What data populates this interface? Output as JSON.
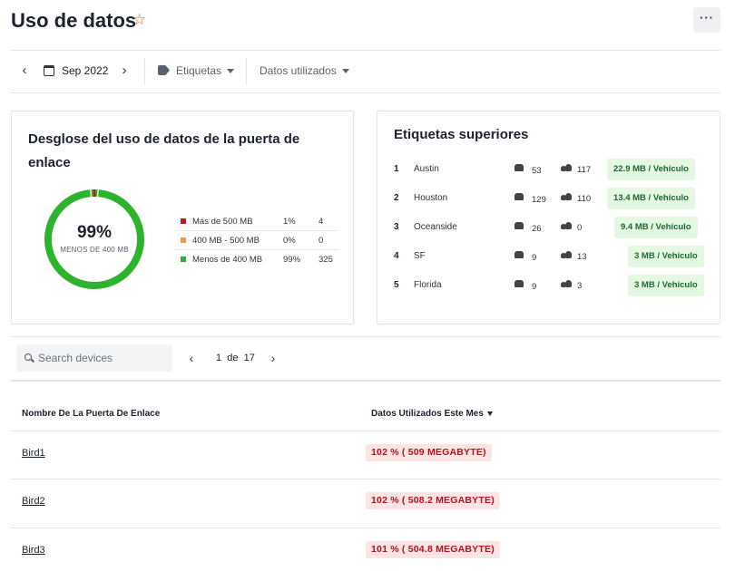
{
  "header": {
    "title": "Uso de datos",
    "favorite_icon": "star-icon",
    "more_label": "···"
  },
  "filters": {
    "prev_label": "‹",
    "next_label": "›",
    "date": "Sep 2022",
    "tags_label": "Etiquetas",
    "data_used_label": "Datos utilizados"
  },
  "breakdown": {
    "title": "Desglose del uso de datos de la puerta de enlace",
    "center_pct": "99%",
    "center_label": "MENOS DE 400 MB",
    "rows": [
      {
        "label": "Más de 500 MB",
        "pct": "1%",
        "count": "4",
        "color": "#c0171d",
        "fraction": 0.01
      },
      {
        "label": "400 MB - 500 MB",
        "pct": "0%",
        "count": "0",
        "color": "#f59a44",
        "fraction": 0.0
      },
      {
        "label": "Menos de 400 MB",
        "pct": "99%",
        "count": "325",
        "color": "#2db32d",
        "fraction": 0.99
      }
    ]
  },
  "top_tags": {
    "title": "Etiquetas superiores",
    "items": [
      {
        "rank": "1",
        "name": "Austin",
        "vehicles": "53",
        "people": "117",
        "badge": "22.9 MB / Vehículo"
      },
      {
        "rank": "2",
        "name": "Houston",
        "vehicles": "129",
        "people": "110",
        "badge": "13.4 MB / Vehículo"
      },
      {
        "rank": "3",
        "name": "Oceanside",
        "vehicles": "26",
        "people": "0",
        "badge": "9.4 MB / Vehículo"
      },
      {
        "rank": "4",
        "name": "SF",
        "vehicles": "9",
        "people": "13",
        "badge": "3 MB / Vehículo"
      },
      {
        "rank": "5",
        "name": "Florida",
        "vehicles": "9",
        "people": "3",
        "badge": "3 MB / Vehículo"
      }
    ]
  },
  "search": {
    "placeholder": "Search devices"
  },
  "pagination": {
    "page": "1",
    "of": "de",
    "total": "17"
  },
  "table": {
    "col_name": "Nombre De La Puerta De Enlace",
    "col_usage": "Datos Utilizados Este Mes",
    "rows": [
      {
        "name": "Bird1",
        "usage": "102 % ( 509 MEGABYTE)"
      },
      {
        "name": "Bird2",
        "usage": "102 % ( 508.2 MEGABYTE)"
      },
      {
        "name": "Bird3",
        "usage": "101 % ( 504.8 MEGABYTE)"
      }
    ]
  }
}
